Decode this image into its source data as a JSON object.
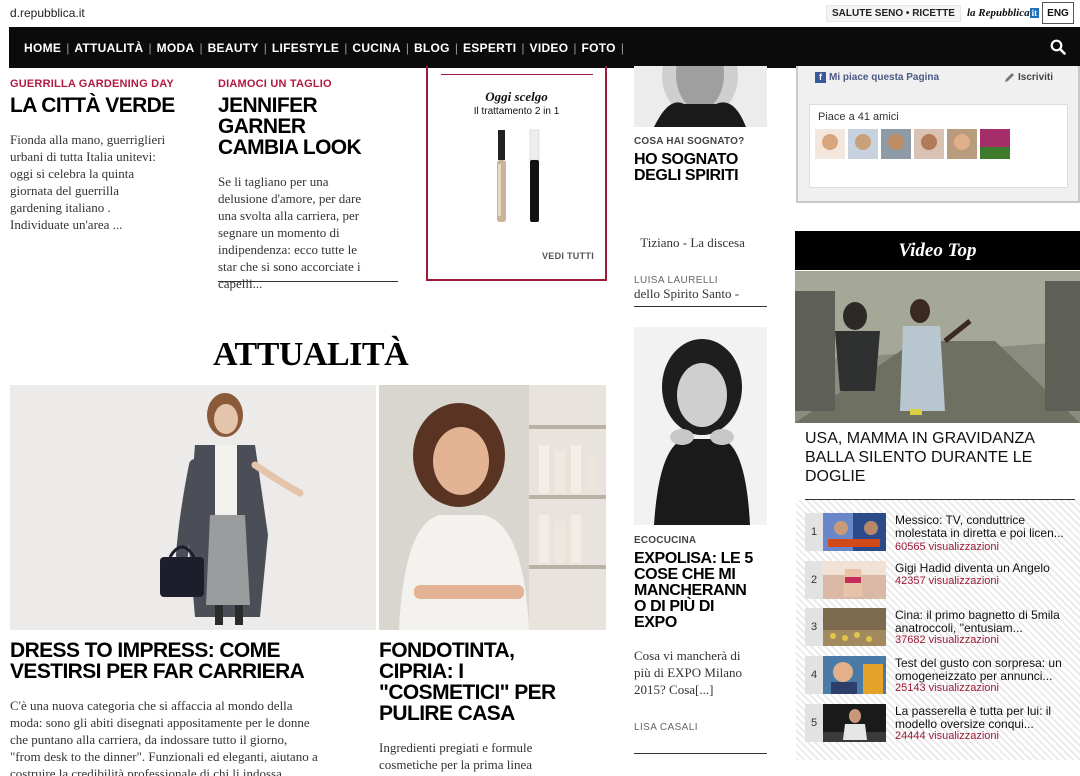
{
  "header": {
    "site_name": "d.repubblica.it",
    "top_links": [
      "SALUTE SENO",
      "•",
      "RICETTE"
    ],
    "logo_text": "la Repubblica",
    "logo_suffix": "it",
    "lang_button": "ENG"
  },
  "nav": {
    "items": [
      "HOME",
      "ATTUALITÀ",
      "MODA",
      "BEAUTY",
      "LIFESTYLE",
      "CUCINA",
      "BLOG",
      "ESPERTI",
      "VIDEO",
      "FOTO"
    ],
    "separator": "|"
  },
  "articles": {
    "a1": {
      "kicker": "GUERRILLA GARDENING DAY",
      "title": "LA CITTÀ VERDE",
      "excerpt": [
        "Fionda alla mano, guerriglieri",
        "urbani di tutta Italia unitevi:",
        "oggi si celebra la quinta",
        "giornata del guerrilla",
        "gardening italiano .",
        "Individuate un'area ..."
      ]
    },
    "a2": {
      "kicker": "DIAMOCI UN TAGLIO",
      "title": [
        "JENNIFER",
        "GARNER",
        "CAMBIA LOOK"
      ],
      "excerpt": [
        "Se li tagliano per una",
        "delusione d'amore, per dare",
        "una svolta alla carriera, per",
        "segnare un momento di",
        "indipendenza: ecco tutte le",
        "star che si sono accorciate i",
        "capelli..."
      ]
    },
    "promo": {
      "title": "Oggi scelgo",
      "subtitle": "Il trattamento 2 in 1",
      "cta": "VEDI TUTTI"
    },
    "a3": {
      "kicker": "COSA HAI SOGNATO?",
      "title": [
        "HO SOGNATO",
        "DEGLI SPIRITI"
      ],
      "excerpt": [
        "  Tiziano - La discesa",
        "dello Spirito Santo -",
        "[...]"
      ],
      "author": "LUISA LAURELLI"
    },
    "section_title": "ATTUALITÀ",
    "a4": {
      "title": [
        "DRESS TO IMPRESS: COME",
        "VESTIRSI PER FAR CARRIERA"
      ],
      "excerpt": [
        "C'è una nuova categoria che si affaccia al mondo della",
        "moda: sono gli abiti disegnati appositamente per le donne",
        "che puntano alla carriera, da indossare tutto il giorno,",
        "\"from desk to the dinner\". Funzionali ed eleganti, aiutano a",
        "costruire la credibilità professionale di chi li indossa"
      ]
    },
    "a5": {
      "title": [
        "FONDOTINTA,",
        "CIPRIA: I",
        "\"COSMETICI\" PER",
        "PULIRE CASA"
      ],
      "excerpt": [
        "Ingredienti pregiati e formule",
        "cosmetiche per la prima linea"
      ]
    },
    "a6": {
      "kicker": "ECOCUCINA",
      "title": [
        "EXPOLISA: LE 5",
        "COSE CHE MI",
        "MANCHERANN",
        "O DI PIÙ DI",
        "EXPO"
      ],
      "excerpt": [
        "Cosa vi mancherà di",
        "più di EXPO Milano",
        "2015? Cosa[...]"
      ],
      "author": "LISA CASALI"
    }
  },
  "facebook": {
    "like_label": "Mi piace questa Pagina",
    "subscribe_label": "Iscriviti",
    "friends_count": "Piace a 41 amici"
  },
  "video": {
    "section_label": "Video Top",
    "main_title": [
      "USA, MAMMA IN GRAVIDANZA",
      "BALLA SILENTO DURANTE LE",
      "DOGLIE"
    ],
    "list": [
      {
        "rank": "1",
        "title1": "Messico: TV, conduttrice",
        "title2": "molestata in diretta e poi licen...",
        "views": "60565 visualizzazioni"
      },
      {
        "rank": "2",
        "title1": "Gigi Hadid diventa un Angelo",
        "title2": "",
        "views": "42357 visualizzazioni"
      },
      {
        "rank": "3",
        "title1": "Cina: il primo bagnetto di 5mila",
        "title2": "anatroccoli, \"entusiam...",
        "views": "37682 visualizzazioni"
      },
      {
        "rank": "4",
        "title1": "Test del gusto con sorpresa: un",
        "title2": "omogeneizzato per annunci...",
        "views": "25143 visualizzazioni"
      },
      {
        "rank": "5",
        "title1": "La passerella è tutta per lui: il",
        "title2": "modello oversize conqui...",
        "views": "24444 visualizzazioni"
      }
    ]
  },
  "colors": {
    "accent": "#b01a43",
    "nav_bg": "#0b0b0b",
    "views": "#9d1b38"
  },
  "icons": {
    "search": "search-icon",
    "facebook": "facebook-icon",
    "pencil": "pencil-icon"
  }
}
